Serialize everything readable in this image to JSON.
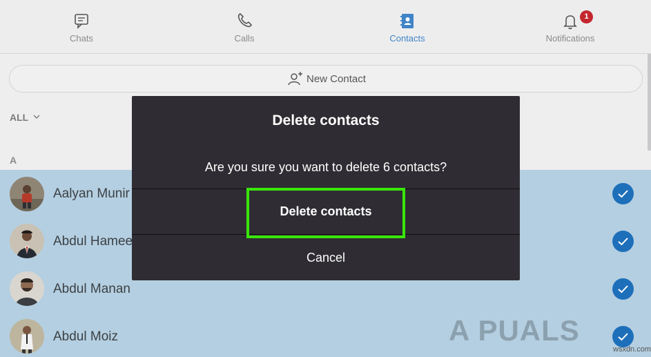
{
  "nav": {
    "tabs": [
      {
        "label": "Chats",
        "icon": "chat-icon"
      },
      {
        "label": "Calls",
        "icon": "phone-icon"
      },
      {
        "label": "Contacts",
        "icon": "contacts-book-icon",
        "active": true
      },
      {
        "label": "Notifications",
        "icon": "bell-icon",
        "badge": "1"
      }
    ]
  },
  "new_contact": {
    "label": "New Contact",
    "icon": "add-person-icon"
  },
  "filter": {
    "label": "ALL"
  },
  "section_letter": "A",
  "contacts": [
    {
      "name": "Aalyan Munir",
      "selected": true
    },
    {
      "name": "Abdul Hameed",
      "selected": true
    },
    {
      "name": "Abdul Manan",
      "selected": true
    },
    {
      "name": "Abdul Moiz",
      "selected": true
    }
  ],
  "dialog": {
    "title": "Delete contacts",
    "message": "Are you sure you want to delete 6 contacts?",
    "confirm_label": "Delete contacts",
    "cancel_label": "Cancel"
  },
  "watermark": {
    "text": "A PUALS",
    "site": "wsxdn.com"
  },
  "colors": {
    "dialog_bg": "#2f2d33",
    "accent": "#3f84c6",
    "check": "#1e6fba",
    "highlight": "#39e60a",
    "badge": "#c4262e"
  }
}
